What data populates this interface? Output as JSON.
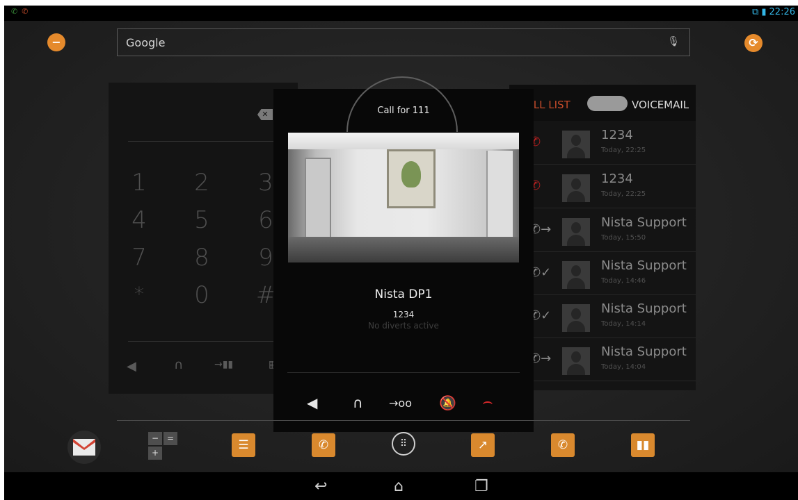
{
  "status_bar": {
    "left_icons": [
      "phone-active-icon",
      "missed-call-icon"
    ],
    "right_icons": [
      "network-icon",
      "battery-icon"
    ],
    "time": "22:26",
    "accent": "#33b5e5"
  },
  "search": {
    "label": "Google",
    "icons": [
      "mic-icon"
    ]
  },
  "dialpad": {
    "keys": [
      "1",
      "2",
      "3",
      "4",
      "5",
      "6",
      "7",
      "8",
      "9",
      "*",
      "0",
      "#"
    ],
    "tools": [
      "speaker-icon",
      "headset-icon",
      "transfer-icon",
      "keypad-icon"
    ]
  },
  "call_list": {
    "tab_call_list": "CALL LIST",
    "tab_voicemail": "VOICEMAIL",
    "accent": "#c44b2a",
    "items": [
      {
        "name": "1234",
        "time": "Today, 22:25",
        "type": "missed"
      },
      {
        "name": "1234",
        "time": "Today, 22:25",
        "type": "missed"
      },
      {
        "name": "Nista Support",
        "time": "Today, 15:50",
        "type": "outgoing"
      },
      {
        "name": "Nista Support",
        "time": "Today, 14:46",
        "type": "incoming"
      },
      {
        "name": "Nista Support",
        "time": "Today, 14:14",
        "type": "incoming"
      },
      {
        "name": "Nista Support",
        "time": "Today, 14:04",
        "type": "outgoing"
      }
    ]
  },
  "call": {
    "call_for": "Call for 111",
    "caller_name": "Nista DP1",
    "caller_number": "1234",
    "divert_status": "No diverts active",
    "buttons": [
      "speaker-icon",
      "headset-icon",
      "voicemail-transfer-icon",
      "mute-icon",
      "hangup-icon"
    ],
    "hangup_color": "#d8282a"
  },
  "dock": {
    "icons": [
      "gmail-icon",
      "calculator-icon",
      "contacts-list-icon",
      "phone-icon",
      "all-apps-icon",
      "call-forward-icon",
      "call-log-icon",
      "book-icon"
    ],
    "accent": "#d9892e"
  },
  "nav_bar": {
    "icons": [
      "back-icon",
      "home-icon",
      "recent-apps-icon"
    ]
  }
}
